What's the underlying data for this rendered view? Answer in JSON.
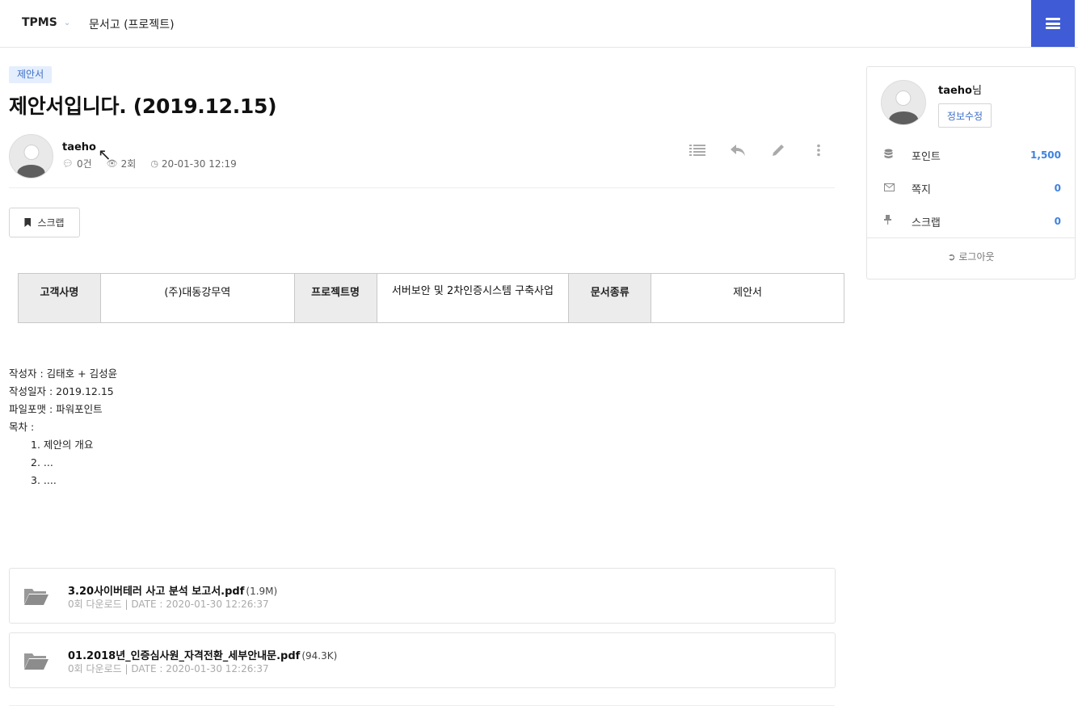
{
  "header": {
    "brand": "TPMS",
    "breadcrumb": "문서고 (프로젝트)",
    "menu_icon": "hamburger-menu-icon"
  },
  "post": {
    "category": "제안서",
    "title": "제안서입니다. (2019.12.15)",
    "author": "taeho",
    "comments": "0건",
    "views": "2회",
    "datetime": "20-01-30 12:19",
    "actions": [
      "list-icon",
      "reply-icon",
      "edit-icon",
      "more-icon"
    ],
    "scrap_label": "스크랩"
  },
  "info_table": {
    "client_label": "고객사명",
    "client_value": "(주)대동강무역",
    "project_label": "프로젝트명",
    "project_value": "서버보안 및 2차인증시스템 구축사업",
    "doctype_label": "문서종류",
    "doctype_value": "제안서"
  },
  "content": {
    "line1": "작성자 : 김태호 + 김성윤",
    "line2": "작성일자 : 2019.12.15",
    "line3": "파일포맷 : 파워포인트",
    "line4": "목차 :",
    "toc": [
      "1. 제안의 개요",
      "2. ...",
      "3. ...."
    ]
  },
  "attachments": [
    {
      "name": "3.20사이버테러 사고 분석 보고서.pdf",
      "size": "(1.9M)",
      "meta": "0회 다운로드 | DATE : 2020-01-30 12:26:37"
    },
    {
      "name": "01.2018년_인증심사원_자격전환_세부안내문.pdf",
      "size": "(94.3K)",
      "meta": "0회 다운로드 | DATE : 2020-01-30 12:26:37"
    }
  ],
  "sidebar": {
    "username": "taeho",
    "honorific": "님",
    "edit_label": "정보수정",
    "points_label": "포인트",
    "points_value": "1,500",
    "memo_label": "쪽지",
    "memo_value": "0",
    "scrap_label": "스크랩",
    "scrap_value": "0",
    "logout_label": "로그아웃"
  },
  "colors": {
    "accent": "#3f5bd6",
    "link": "#3e82e0",
    "badge_bg": "#e4eefc",
    "table_header_bg": "#ececec"
  }
}
